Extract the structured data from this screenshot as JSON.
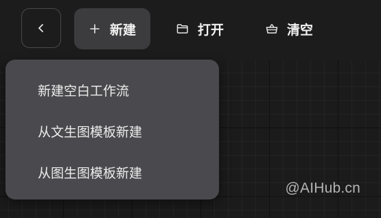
{
  "toolbar": {
    "back_icon": "chevron-left-icon",
    "new_label": "新建",
    "new_icon": "plus-icon",
    "open_label": "打开",
    "open_icon": "folder-icon",
    "clear_label": "清空",
    "clear_icon": "basket-icon"
  },
  "new_menu": {
    "items": [
      {
        "label": "新建空白工作流"
      },
      {
        "label": "从文生图模板新建"
      },
      {
        "label": "从图生图模板新建"
      }
    ]
  },
  "watermark": "@AIHub.cn",
  "colors": {
    "background": "#1a1a1a",
    "active_button": "#3c3c3e",
    "dropdown": "#4a4a4e",
    "text": "#f2f2f2"
  }
}
